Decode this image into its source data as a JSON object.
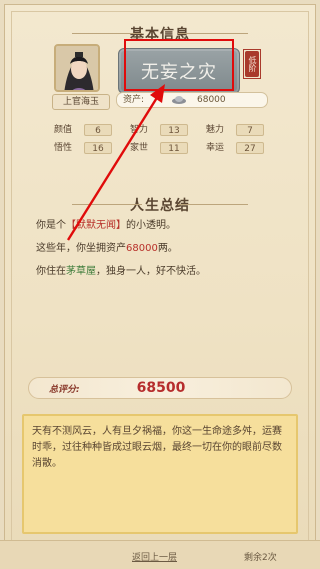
{
  "sections": {
    "basic_info_title": "基本信息",
    "life_summary_title": "人生总结"
  },
  "character": {
    "name": "上官海玉",
    "title": "无妄之灾",
    "title_badge": "低阶",
    "assets_label": "资产:",
    "assets_value": "68000"
  },
  "stats": [
    {
      "label": "颜值",
      "value": "6"
    },
    {
      "label": "智力",
      "value": "13"
    },
    {
      "label": "魅力",
      "value": "7"
    },
    {
      "label": "悟性",
      "value": "16"
    },
    {
      "label": "家世",
      "value": "11"
    },
    {
      "label": "幸运",
      "value": "27"
    }
  ],
  "summary": {
    "line1_prefix": "你是个",
    "line1_em": "【默默无闻】",
    "line1_suffix": "的小透明。",
    "line2_prefix": "这些年，你坐拥资产",
    "line2_em": "68000",
    "line2_suffix": "两。",
    "line3_prefix": "你住在",
    "line3_em": "茅草屋",
    "line3_suffix": "，独身一人，好不快活。"
  },
  "score": {
    "label": "总评分:",
    "value": "68500"
  },
  "note_text": "天有不测风云，人有旦夕祸福，你这一生命途多舛，运赛时乖，过往种种皆成过眼云烟，最终一切在你的眼前尽数消散。",
  "bottom": {
    "prev_button": "返回上一层",
    "remaining": "剩余2次"
  },
  "colors": {
    "highlight_red": "#e00b0b",
    "score_red": "#b62d2d",
    "note_bg": "#f6df9c"
  },
  "icons": {
    "silver": "silver-ingot-icon",
    "arrow": "red-arrow-icon"
  }
}
